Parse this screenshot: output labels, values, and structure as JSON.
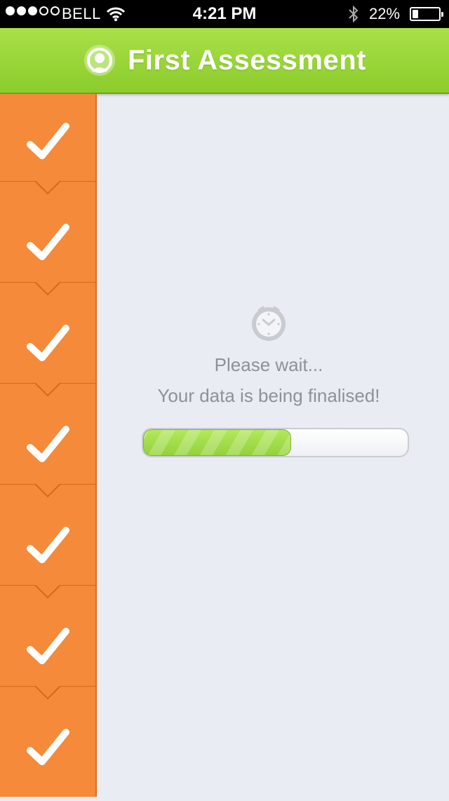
{
  "status_bar": {
    "signal_dots": [
      true,
      true,
      true,
      false,
      false
    ],
    "carrier": "BELL",
    "time": "4:21 PM",
    "battery_text": "22%",
    "battery_level": 0.22,
    "icons": [
      "wifi-icon",
      "bluetooth-icon",
      "battery-icon"
    ]
  },
  "header": {
    "title": "First Assessment",
    "icon": "profile-badge-icon",
    "color": "#9bd83d"
  },
  "sidebar": {
    "color": "#f48a3a",
    "steps": [
      {
        "status": "complete",
        "icon": "checkmark-icon"
      },
      {
        "status": "complete",
        "icon": "checkmark-icon"
      },
      {
        "status": "complete",
        "icon": "checkmark-icon"
      },
      {
        "status": "complete",
        "icon": "checkmark-icon"
      },
      {
        "status": "complete",
        "icon": "checkmark-icon"
      },
      {
        "status": "complete",
        "icon": "checkmark-icon"
      },
      {
        "status": "complete",
        "icon": "checkmark-icon"
      }
    ]
  },
  "main": {
    "icon": "clock-icon",
    "message_line1": "Please wait...",
    "message_line2": "Your data is being finalised!",
    "progress_fraction": 0.56,
    "progress_color": "#9fdc46"
  }
}
